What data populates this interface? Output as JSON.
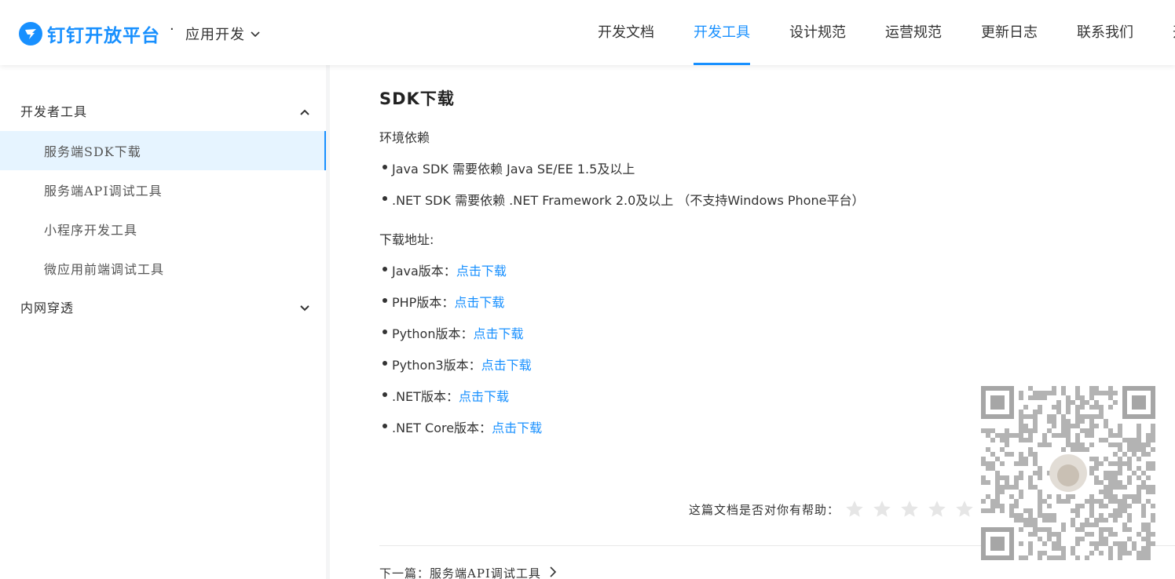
{
  "header": {
    "logo_text": "钉钉开放平台",
    "separator": "·",
    "app_select_label": "应用开发",
    "nav": [
      {
        "label": "开发文档",
        "active": false
      },
      {
        "label": "开发工具",
        "active": true
      },
      {
        "label": "设计规范",
        "active": false
      },
      {
        "label": "运营规范",
        "active": false
      },
      {
        "label": "更新日志",
        "active": false
      },
      {
        "label": "联系我们",
        "active": false
      },
      {
        "label": "开",
        "active": false
      }
    ]
  },
  "sidebar": {
    "group1": {
      "label": "开发者工具",
      "expanded": true
    },
    "items": [
      {
        "label": "服务端SDK下载",
        "active": true
      },
      {
        "label": "服务端API调试工具",
        "active": false
      },
      {
        "label": "小程序开发工具",
        "active": false
      },
      {
        "label": "微应用前端调试工具",
        "active": false
      }
    ],
    "group2": {
      "label": "内网穿透",
      "expanded": false
    }
  },
  "main": {
    "title": "SDK下载",
    "env_heading": "环境依赖",
    "env_items": [
      "Java SDK 需要依赖 Java SE/EE 1.5及以上",
      ".NET SDK 需要依赖 .NET Framework 2.0及以上 （不支持Windows Phone平台）"
    ],
    "download_heading": "下载地址:",
    "downloads": [
      {
        "label": "Java版本：",
        "link": "点击下载"
      },
      {
        "label": "PHP版本：",
        "link": "点击下载"
      },
      {
        "label": "Python版本：",
        "link": "点击下载"
      },
      {
        "label": "Python3版本：",
        "link": "点击下载"
      },
      {
        "label": ".NET版本：",
        "link": "点击下载"
      },
      {
        "label": ".NET Core版本：",
        "link": "点击下载"
      }
    ],
    "rating_label": "这篇文档是否对你有帮助：",
    "rating_stars": 5,
    "rating_value": 0,
    "next_label": "下一篇：服务端API调试工具"
  },
  "colors": {
    "accent": "#1890ff",
    "active_bg": "#e6f4ff",
    "star": "#e6e6e6"
  },
  "icons": {
    "logo": "dingtalk-logo-icon",
    "dropdown": "chevron-down-icon",
    "collapse": "chevron-up-icon",
    "next": "chevron-right-icon",
    "star": "star-icon",
    "qr": "qr-code-icon"
  }
}
